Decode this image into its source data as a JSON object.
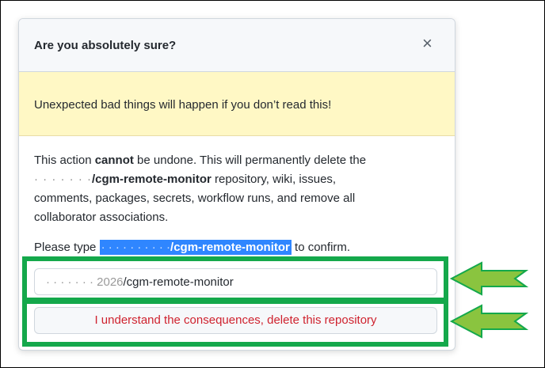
{
  "dialog": {
    "title": "Are you absolutely sure?",
    "close_glyph": "×",
    "warning": "Unexpected bad things will happen if you don’t read this!",
    "body": {
      "p1_a": "This action ",
      "p1_b": "cannot",
      "p1_c": " be undone. This will permanently delete the",
      "repo_blur": "· · · · ·  · ·",
      "repo_name": "/cgm-remote-monitor",
      "p1_d": " repository, wiki, issues,",
      "line3": "comments, packages, secrets, workflow runs, and remove all",
      "line4": "collaborator associations."
    },
    "confirm": {
      "prefix": "Please type ",
      "highlight_blur": "· · · · · · · · · ·",
      "highlight_name": "/cgm-remote-monitor",
      "suffix": " to confirm."
    },
    "input": {
      "value_blur": "· ·  · · · · · 2026",
      "value_name": "/cgm-remote-monitor"
    },
    "delete_button": "I understand the consequences, delete this repository"
  },
  "colors": {
    "highlight_border": "#14a84b",
    "arrow_fill": "#8ac43f",
    "danger": "#cf222e"
  }
}
